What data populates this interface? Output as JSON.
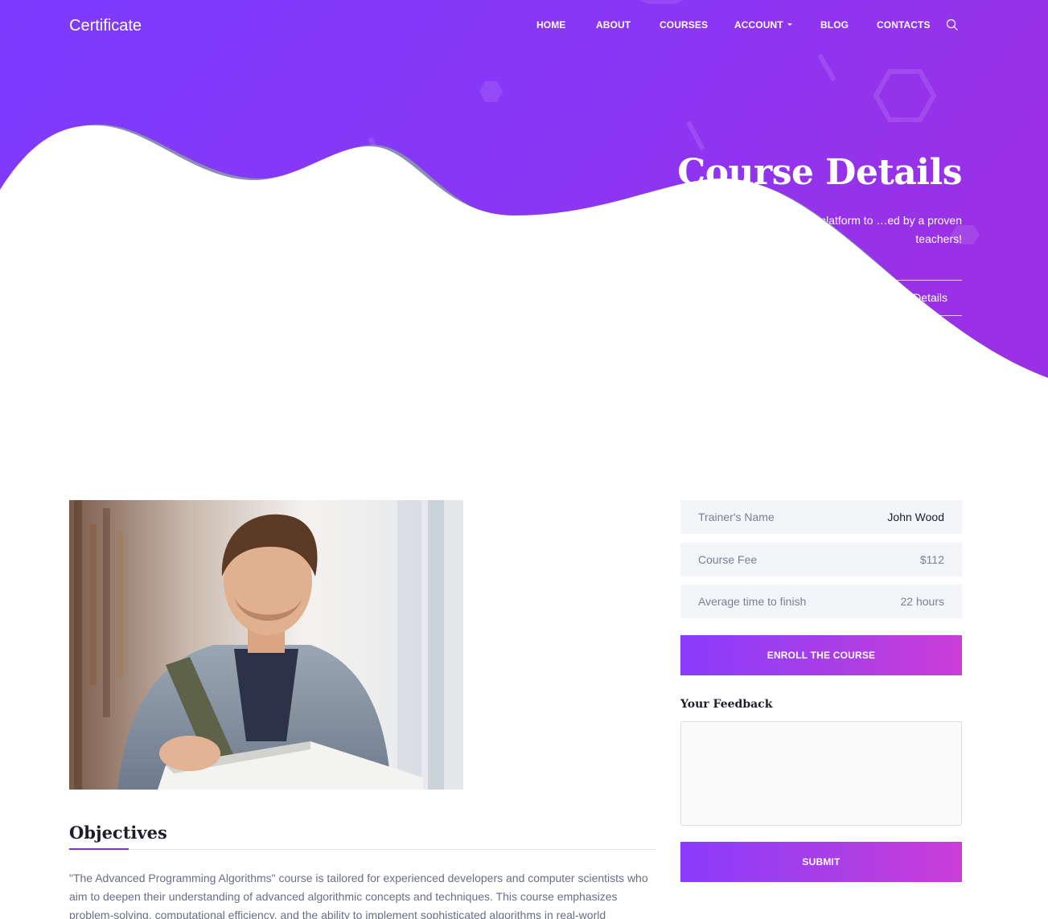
{
  "brand": {
    "name": "Certificate"
  },
  "nav": {
    "items": [
      {
        "label": "HOME"
      },
      {
        "label": "ABOUT"
      },
      {
        "label": "COURSES"
      },
      {
        "label": "ACCOUNT",
        "dropdown": true
      },
      {
        "label": "BLOG"
      },
      {
        "label": "CONTACTS"
      }
    ],
    "search_icon": "search-icon"
  },
  "hero": {
    "title": "Course Details",
    "subtitle": "…t famous E-Learn platform to …ed by a proven teachers!",
    "breadcrumb": "… Details"
  },
  "course_info": [
    {
      "label": "Trainer's Name",
      "value": "John Wood"
    },
    {
      "label": "Course Fee",
      "value": "$112"
    },
    {
      "label": "Average time to finish",
      "value": "22 hours"
    }
  ],
  "enroll_button": "ENROLL THE COURSE",
  "feedback": {
    "label": "Your Feedback",
    "placeholder": "",
    "submit": "SUBMIT"
  },
  "objectives": {
    "title": "Objectives",
    "text": "\"The Advanced Programming Algorithms\" course is tailored for experienced developers and computer scientists who aim to deepen their understanding of advanced algorithmic concepts and techniques. This course emphasizes problem-solving, computational efficiency, and the ability to implement sophisticated algorithms in real-world"
  },
  "colors": {
    "hero_start": "#7f3cff",
    "hero_end": "#9b33e8",
    "wave_shadow": "#8a8db8",
    "accent": "#8a2be2",
    "button_start": "#8a3bfc",
    "button_end": "#cb3dd8"
  }
}
